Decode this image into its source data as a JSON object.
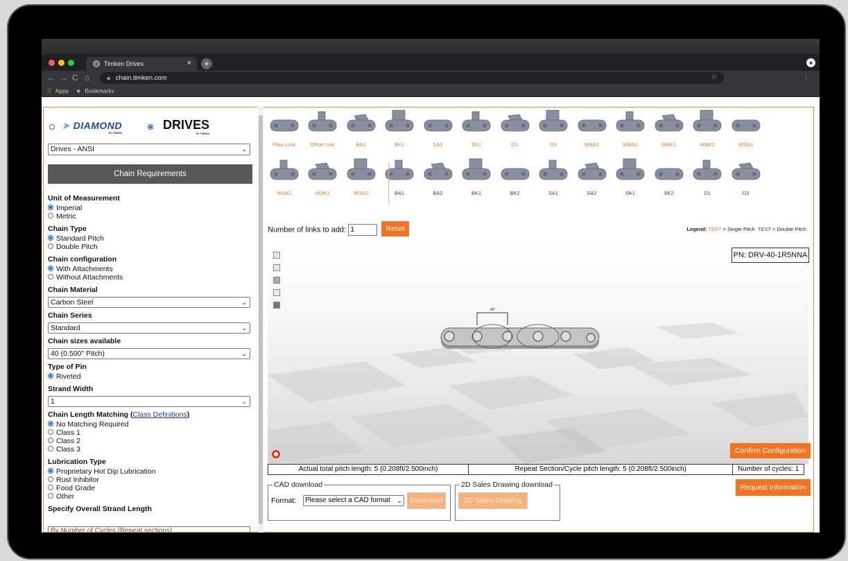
{
  "browser": {
    "tab_title": "Timken Drives",
    "tab_close": "×",
    "new_tab": "+",
    "url": "chain.timken.com",
    "bookmarks": {
      "apps": "Apps",
      "bookmarks": "Bookmarks"
    }
  },
  "brand": {
    "diamond": "DIAMOND",
    "diamond_sub": "BY TIMKEN",
    "drives": "DRIVES",
    "drives_sub": "BY TIMKEN",
    "catalog_select": "Drives - ANSI"
  },
  "sidebar": {
    "header": "Chain Requirements",
    "unit_label": "Unit of Measurement",
    "unit_options": [
      "Imperial",
      "Metric"
    ],
    "chain_type_label": "Chain Type",
    "chain_type_options": [
      "Standard Pitch",
      "Double Pitch"
    ],
    "config_label": "Chain configuration",
    "config_options": [
      "With Attachments",
      "Without Attachments"
    ],
    "material_label": "Chain Material",
    "material_value": "Carbon Steel",
    "series_label": "Chain Series",
    "series_value": "Standard",
    "sizes_label": "Chain sizes available",
    "sizes_value": "40 (0.500\" Pitch)",
    "pin_label": "Type of Pin",
    "pin_options": [
      "Riveted"
    ],
    "strand_label": "Strand Width",
    "strand_value": "1",
    "matching_label": "Chain Length Matching",
    "matching_link": "Class Definitions",
    "matching_options": [
      "No Matching Required",
      "Class 1",
      "Class 2",
      "Class 3"
    ],
    "lube_label": "Lubrication Type",
    "lube_options": [
      "Proprietary Hot Dip Lubrication",
      "Rust Inhibitor",
      "Food Grade",
      "Other"
    ],
    "overall_label": "Specify Overall Strand Length",
    "overall_value": "By Number of Cycles (Repeat sections)"
  },
  "links_single": [
    "Plain Link",
    "Offset Link",
    "BA1",
    "BK1",
    "SA1",
    "SK1",
    "D1",
    "D3",
    "WBA1",
    "WBA2",
    "WBK1",
    "WBK2",
    "WSA1",
    "WSA2",
    "WSK1",
    "WSK2"
  ],
  "links_double": [
    "BA1",
    "BA2",
    "BK1",
    "BK2",
    "SA1",
    "SA2",
    "SK1",
    "SK2",
    "D1",
    "D3"
  ],
  "controls": {
    "links_label": "Number of links to add:",
    "links_value": "1",
    "reset": "Reset",
    "legend_prefix": "Legend:",
    "legend_single_text": "TEXT",
    "legend_single": "= Single Pitch",
    "legend_double_text": "TEXT",
    "legend_double": "= Double Pitch",
    "part_number": "PN: DRV-40-1R5NNA",
    "dimension_tag": ".48\"",
    "confirm": "Confirm Configuration"
  },
  "stats": {
    "total_pitch": "Actual total pitch length: 5 (0.208ft/2.500inch)",
    "repeat_pitch": "Repeat Section/Cycle pitch length: 5 (0.208ft/2.500inch)",
    "cycles": "Number of cycles: 1"
  },
  "cad": {
    "legend": "CAD download",
    "format_label": "Format:",
    "format_value": "Please select a CAD format",
    "download": "Download"
  },
  "sales": {
    "legend": "2D Sales Drawing download",
    "button": "2D Sales Drawing"
  },
  "request_info": "Request Information",
  "colors": {
    "accent": "#f37321",
    "single": "#e8782a",
    "double": "#2a3f8f",
    "header": "#555759"
  }
}
